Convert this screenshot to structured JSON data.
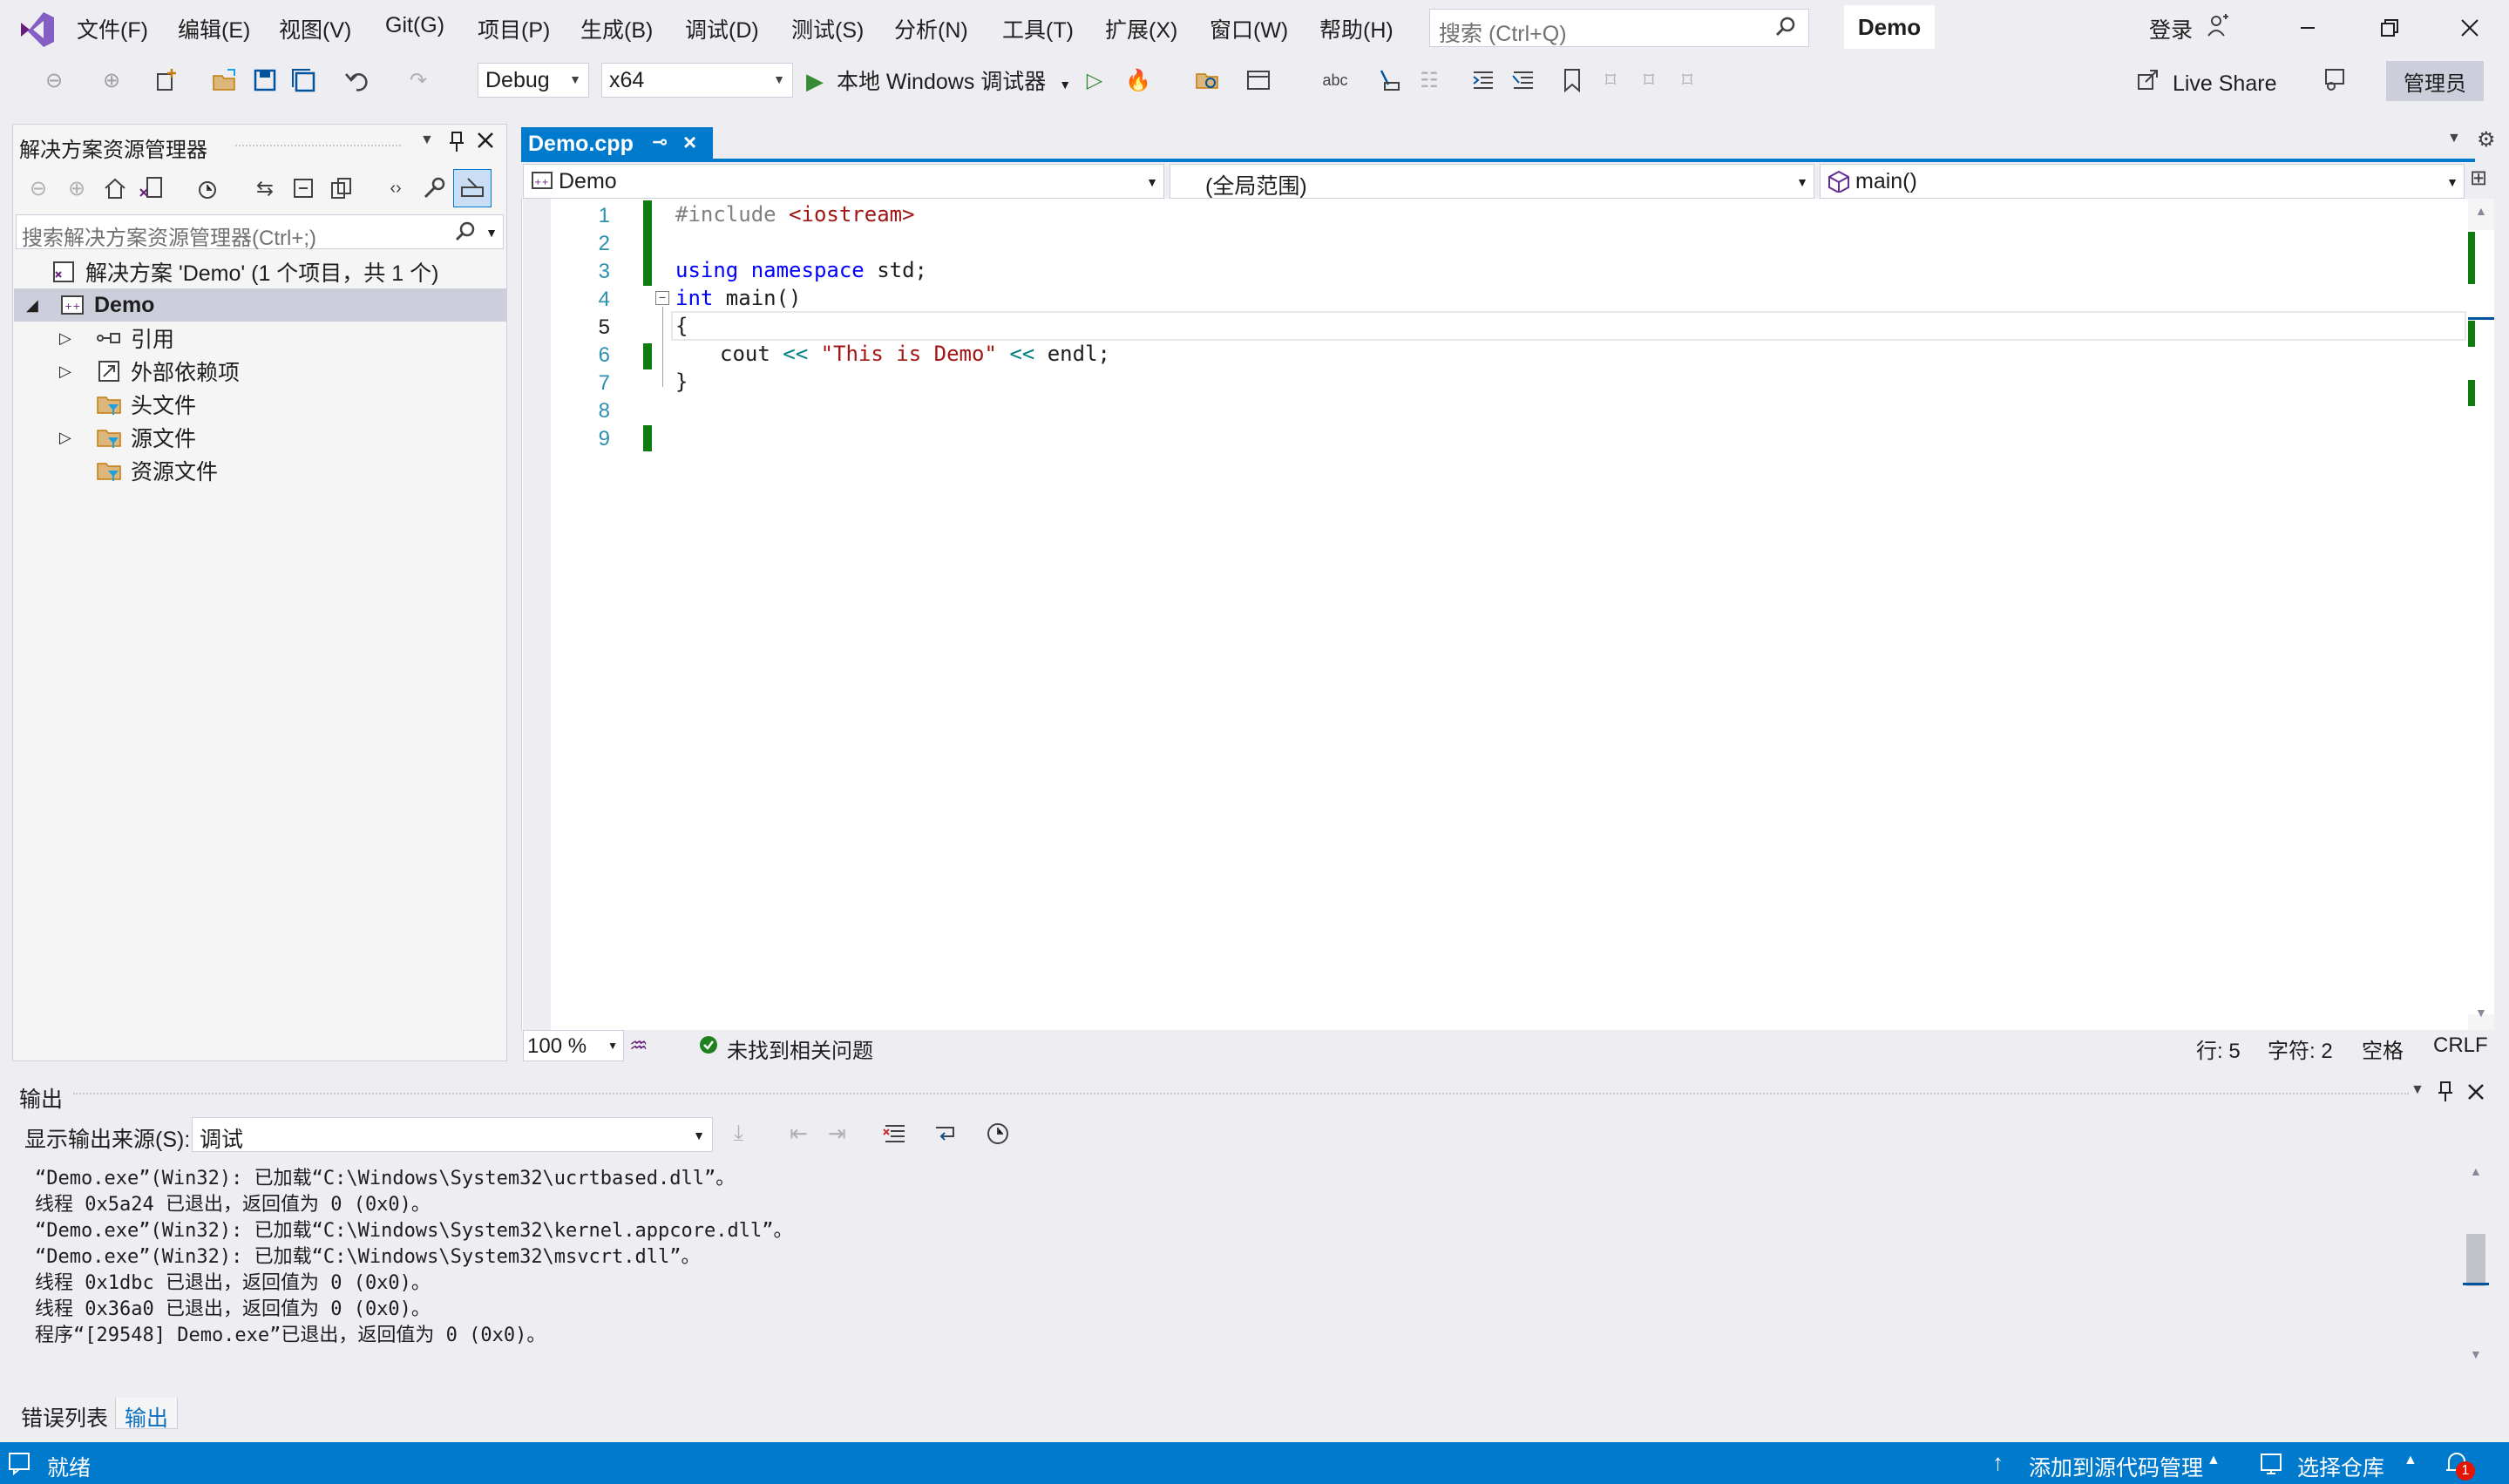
{
  "menu": [
    "文件(F)",
    "编辑(E)",
    "视图(V)",
    "Git(G)",
    "项目(P)",
    "生成(B)",
    "调试(D)",
    "测试(S)",
    "分析(N)",
    "工具(T)",
    "扩展(X)",
    "窗口(W)",
    "帮助(H)"
  ],
  "search": {
    "placeholder": "搜索 (Ctrl+Q)"
  },
  "solution_name": "Demo",
  "account": {
    "login": "登录"
  },
  "toolbar": {
    "config": "Debug",
    "platform": "x64",
    "run_label": "本地 Windows 调试器",
    "live_share": "Live Share",
    "admin": "管理员"
  },
  "solution_explorer": {
    "title": "解决方案资源管理器",
    "search_placeholder": "搜索解决方案资源管理器(Ctrl+;)",
    "solution_label": "解决方案 'Demo' (1 个项目，共 1 个)",
    "project": "Demo",
    "items": [
      "引用",
      "外部依赖项",
      "头文件",
      "源文件",
      "资源文件"
    ]
  },
  "editor": {
    "tab": "Demo.cpp",
    "nav_project": "Demo",
    "nav_scope": "(全局范围)",
    "nav_member": "main()",
    "line_numbers": [
      "1",
      "2",
      "3",
      "4",
      "5",
      "6",
      "7",
      "8",
      "9"
    ],
    "code": {
      "l1_directive": "#include",
      "l1_header": "<iostream>",
      "l3_using": "using",
      "l3_namespace": "namespace",
      "l3_rest": " std;",
      "l4_int": "int",
      "l4_rest": " main()",
      "l5": "{",
      "l6_cout": "cout",
      "l6_op": "<<",
      "l6_str": "\"This is Demo\"",
      "l6_endl": "endl;",
      "l7": "}"
    },
    "zoom": "100 %",
    "issues": "未找到相关问题",
    "row": "行: 5",
    "col": "字符: 2",
    "spacing": "空格",
    "eol": "CRLF"
  },
  "output": {
    "title": "输出",
    "source_label": "显示输出来源(S):",
    "source": "调试",
    "lines": [
      "“Demo.exe”(Win32): 已加载“C:\\Windows\\System32\\ucrtbased.dll”。",
      "线程 0x5a24 已退出，返回值为 0 (0x0)。",
      "“Demo.exe”(Win32): 已加载“C:\\Windows\\System32\\kernel.appcore.dll”。",
      "“Demo.exe”(Win32): 已加载“C:\\Windows\\System32\\msvcrt.dll”。",
      "线程 0x1dbc 已退出，返回值为 0 (0x0)。",
      "线程 0x36a0 已退出，返回值为 0 (0x0)。",
      "程序“[29548] Demo.exe”已退出，返回值为 0 (0x0)。"
    ]
  },
  "bottom_tabs": {
    "errors": "错误列表",
    "output": "输出"
  },
  "status": {
    "ready": "就绪",
    "add_source": "添加到源代码管理",
    "select_repo": "选择仓库",
    "notifications": "1"
  }
}
